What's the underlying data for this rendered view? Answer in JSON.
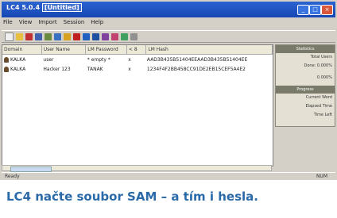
{
  "window": {
    "title_app": "LC4 5.0.4",
    "title_doc": "[Untitled]",
    "title_btn_min": "_",
    "title_btn_max": "□",
    "title_btn_close": "×"
  },
  "menu": [
    "File",
    "View",
    "Import",
    "Session",
    "Help"
  ],
  "toolbar": {
    "icons": [
      "new-file-icon",
      "open-folder-icon",
      "save-icon",
      "import-icon",
      "session-icon",
      "options-icon",
      "help-icon",
      "stop-icon",
      "play-icon",
      "pause-icon",
      "report-icon",
      "wizard-icon",
      "settings-icon",
      "help-contents-icon"
    ]
  },
  "accounts": {
    "columns": [
      "Domain",
      "User Name",
      "LM Password",
      "< 8",
      "LM Hash"
    ],
    "rows": [
      [
        "KALKA",
        "user",
        "* empty *",
        "x",
        "AAD3B435B51404EEAAD3B435B51404EE"
      ],
      [
        "KALKA",
        "Hacker 123",
        "TANAK",
        "x",
        "1234F4F2BB458CC91DE2EB15CEF5A4E2"
      ]
    ]
  },
  "side_panel": {
    "sec1_title": "Statistics",
    "sec1_lines": [
      "Total Users",
      "Done: 0.000%",
      "",
      "0.000%",
      ""
    ],
    "sec2_title": "Progress",
    "sec2_lines": [
      "Current Word",
      "Elapsed Time",
      "Time Left",
      "",
      "",
      ""
    ]
  },
  "status": {
    "left": "Ready",
    "right": "NUM"
  },
  "caption": "LC4 načte soubor SAM – a tím i hesla.",
  "colors": {
    "titlebar": "#1f56c2",
    "caption": "#2a6aa8",
    "chrome": "#d4d0c8"
  }
}
